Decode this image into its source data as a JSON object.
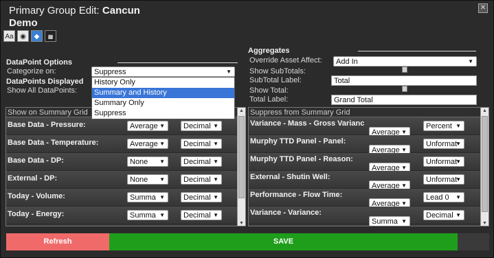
{
  "dialog": {
    "title_prefix": "Primary Group Edit:",
    "title_name": "Cancun Demo",
    "close_icon": "close-icon"
  },
  "toolbar": {
    "icons": [
      {
        "name": "font-size-icon",
        "glyph": "Aa"
      },
      {
        "name": "eye-icon",
        "glyph": "👁"
      },
      {
        "name": "cube-icon",
        "glyph": "◆"
      },
      {
        "name": "grid-icon",
        "glyph": "▦"
      }
    ]
  },
  "datapoint_options": {
    "title": "DataPoint Options",
    "categorize_label": "Categorize on:",
    "categorize_value": "Suppress",
    "displayed_title": "DataPoints Displayed",
    "show_all_label": "Show All DataPoints:",
    "dropdown_options": [
      "History Only",
      "Summary and History",
      "Summary Only",
      "Suppress"
    ],
    "highlighted_option": "Summary and History"
  },
  "aggregates": {
    "title": "Aggregates",
    "override_label": "Override Asset Affect:",
    "override_value": "Add In",
    "show_subtotals_label": "Show SubTotals:",
    "subtotal_label_label": "SubTotal Label:",
    "subtotal_label_value": "Total",
    "show_total_label": "Show Total:",
    "total_label_label": "Total Label:",
    "total_label_value": "Grand Total"
  },
  "left_grid": {
    "header": "Show on Summary Grid",
    "rows": [
      {
        "name": "Base Data - Pressure:",
        "agg": "Average",
        "format": "Decimal"
      },
      {
        "name": "Base Data - Temperature:",
        "agg": "Average",
        "format": "Decimal"
      },
      {
        "name": "Base Data - DP:",
        "agg": "None",
        "format": "Decimal"
      },
      {
        "name": "External - DP:",
        "agg": "None",
        "format": "Decimal"
      },
      {
        "name": "Today - Volume:",
        "agg": "Summa",
        "format": "Decimal"
      },
      {
        "name": "Today - Energy:",
        "agg": "Summa",
        "format": "Decimal"
      }
    ]
  },
  "right_grid": {
    "header": "Suppress from Summary Grid",
    "rows": [
      {
        "name": "Variance - Mass - Gross Varianc",
        "agg": "Average",
        "format": "Percent"
      },
      {
        "name": "Murphy TTD Panel - Panel:",
        "agg": "Average",
        "format": "Unformatted"
      },
      {
        "name": "Murphy TTD Panel - Reason:",
        "agg": "Average",
        "format": "Unformatted"
      },
      {
        "name": "External - Shutin Well:",
        "agg": "Average",
        "format": "Unformatted"
      },
      {
        "name": "Performance - Flow Time:",
        "agg": "Average",
        "format": "Lead 0"
      },
      {
        "name": "Variance - Variance:",
        "agg": "Summa",
        "format": "Decimal"
      }
    ]
  },
  "buttons": {
    "refresh": "Refresh",
    "save": "SAVE"
  },
  "colors": {
    "refresh": "#f06a6a",
    "save": "#1f9e1c",
    "highlight": "#3875d7"
  }
}
